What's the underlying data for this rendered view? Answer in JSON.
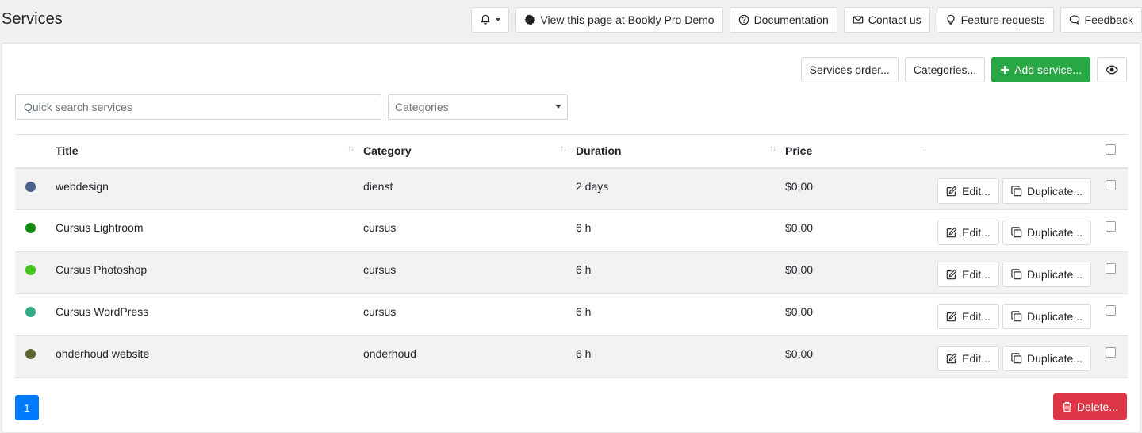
{
  "page": {
    "title": "Services"
  },
  "top_bar": {
    "view_demo_label": "View this page at Bookly Pro Demo",
    "documentation_label": "Documentation",
    "contact_label": "Contact us",
    "feature_requests_label": "Feature requests",
    "feedback_label": "Feedback"
  },
  "actions": {
    "services_order_label": "Services order...",
    "categories_label": "Categories...",
    "add_service_label": "Add service..."
  },
  "filters": {
    "search_placeholder": "Quick search services",
    "category_selected": "Categories"
  },
  "table": {
    "columns": [
      "Title",
      "Category",
      "Duration",
      "Price"
    ],
    "edit_label": "Edit...",
    "duplicate_label": "Duplicate...",
    "rows": [
      {
        "title": "webdesign",
        "category": "dienst",
        "duration": "2 days",
        "price": "$0,00",
        "color": "#4a5f8c"
      },
      {
        "title": "Cursus Lightroom",
        "category": "cursus",
        "duration": "6 h",
        "price": "$0,00",
        "color": "#128a12"
      },
      {
        "title": "Cursus Photoshop",
        "category": "cursus",
        "duration": "6 h",
        "price": "$0,00",
        "color": "#45c21b"
      },
      {
        "title": "Cursus WordPress",
        "category": "cursus",
        "duration": "6 h",
        "price": "$0,00",
        "color": "#35ab88"
      },
      {
        "title": "onderhoud website",
        "category": "onderhoud",
        "duration": "6 h",
        "price": "$0,00",
        "color": "#5e6630"
      }
    ]
  },
  "pagination": {
    "current_page": "1"
  },
  "footer": {
    "delete_label": "Delete..."
  },
  "colors": {
    "primary": "#007bff",
    "success": "#28a745",
    "danger": "#dc3545"
  }
}
